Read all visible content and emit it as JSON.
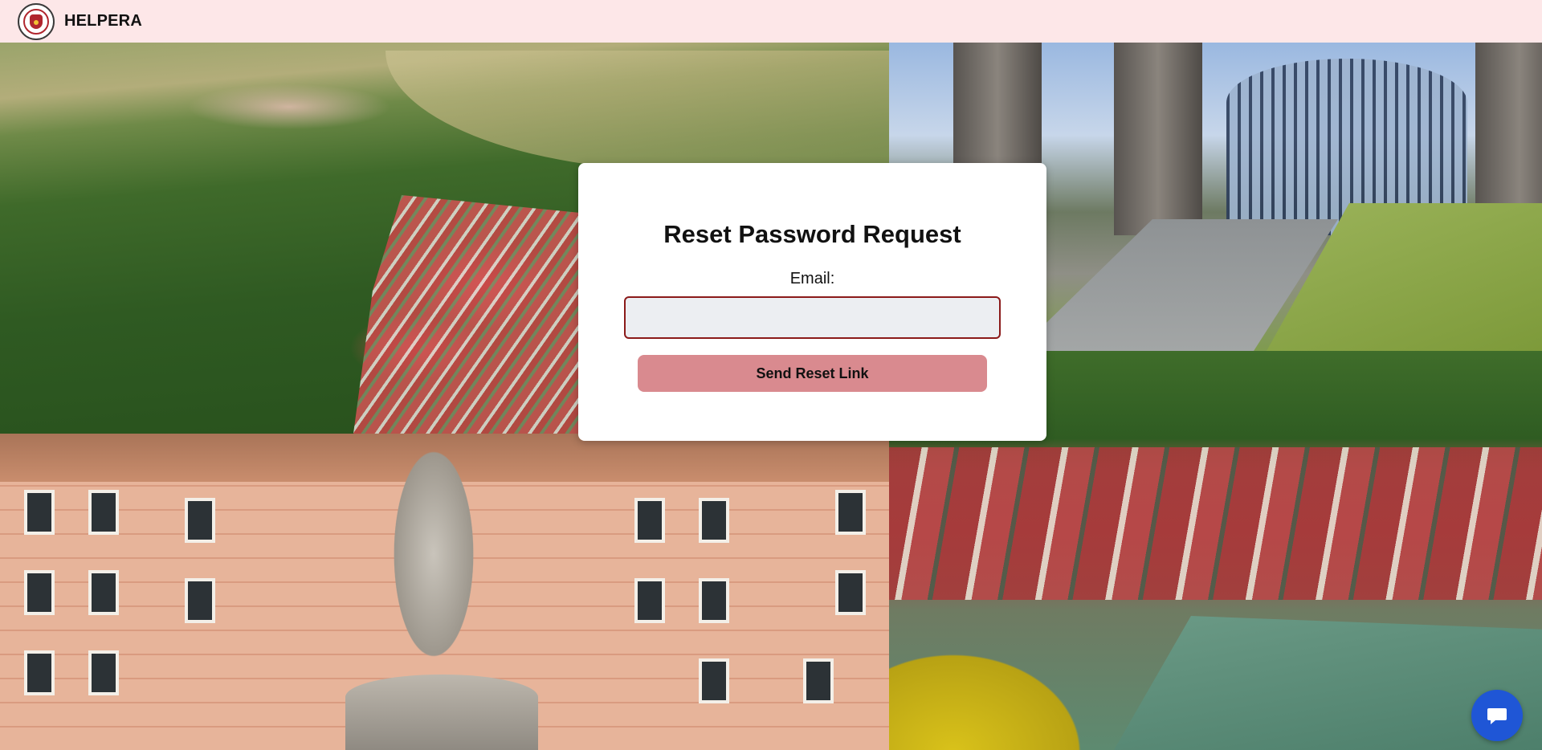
{
  "header": {
    "brand": "HELPERA",
    "logo_icon": "association-seal-logo",
    "background_color": "#fde7e8"
  },
  "form": {
    "title": "Reset Password Request",
    "email_label": "Email:",
    "email_value": "",
    "email_placeholder": "",
    "submit_label": "Send Reset Link",
    "submit_color": "#d98a8f",
    "input_border_color": "#8b1a1a"
  },
  "chat": {
    "icon": "chat-bubble-icon",
    "color": "#1f56d6"
  }
}
